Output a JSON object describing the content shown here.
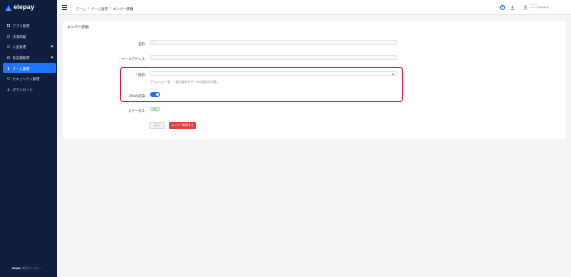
{
  "brand": {
    "name": "elepay"
  },
  "sidebar": {
    "items": [
      {
        "label": "アプリ管理",
        "icon": "apps-icon"
      },
      {
        "label": "決済情報",
        "icon": "payment-icon"
      },
      {
        "label": "入金管理",
        "icon": "deposit-icon",
        "has_children": true
      },
      {
        "label": "各店舗管理",
        "icon": "store-icon",
        "has_children": true
      },
      {
        "label": "チーム管理",
        "icon": "team-icon",
        "active": true
      },
      {
        "label": "セキュリティ管理",
        "icon": "security-icon"
      },
      {
        "label": "ダウンロード",
        "icon": "download-icon"
      }
    ],
    "footer": {
      "brand": "elepay",
      "left": "決済のしくみ",
      "right": "○○"
    }
  },
  "header": {
    "breadcrumb": [
      "ホーム",
      "チーム管理",
      "メンバー詳細"
    ],
    "separator": "/",
    "help_glyph": "?",
    "user": {
      "name": "○○○○○○",
      "email": "○○○○○○@elepay.jp"
    }
  },
  "member_detail": {
    "title": "メンバー詳細",
    "fields": {
      "name": {
        "label": "名前：",
        "value": "○○"
      },
      "email": {
        "label": "メールアドレス：",
        "value": ""
      },
      "role": {
        "label": "役割：",
        "value": "",
        "hint": "デベロッパー権、一部の操作がデータの閲覧が可能。"
      },
      "two_factor": {
        "label": "2FAの必須：",
        "enabled": true
      },
      "status": {
        "label": "ステータス：",
        "value": "有効"
      }
    },
    "required_mark": "*",
    "buttons": {
      "cancel": "戻る",
      "delete": "メンバー削除する"
    }
  },
  "colors": {
    "sidebar": "#0f1f3d",
    "accent": "#1e73ff",
    "danger": "#e53e3e",
    "highlight": "#d81b60"
  }
}
